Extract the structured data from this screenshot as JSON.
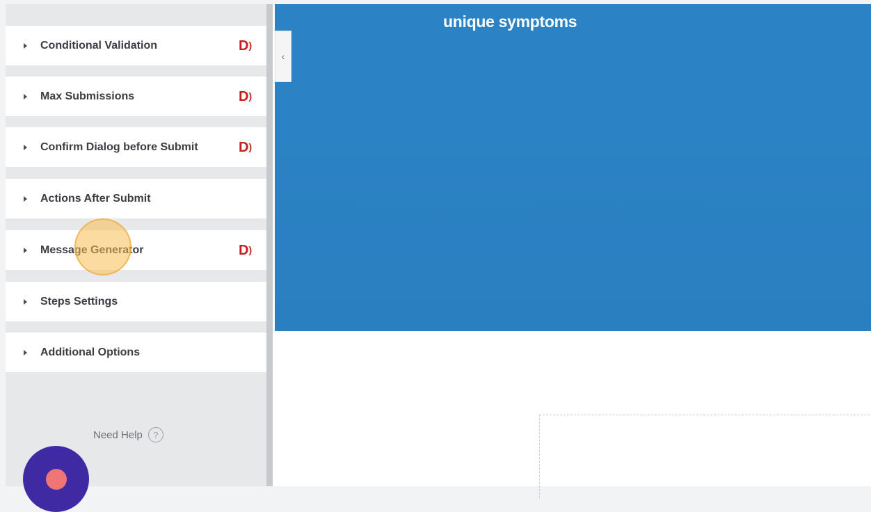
{
  "sidebar": {
    "sections": [
      {
        "label": "Conditional Validation",
        "pro": true
      },
      {
        "label": "Max Submissions",
        "pro": true
      },
      {
        "label": "Confirm Dialog before Submit",
        "pro": true
      },
      {
        "label": "Actions After Submit",
        "pro": false
      },
      {
        "label": "Message Generator",
        "pro": true
      },
      {
        "label": "Steps Settings",
        "pro": false
      },
      {
        "label": "Additional Options",
        "pro": false
      }
    ],
    "pro_badge_text": "D",
    "pro_badge_color": "#c2201d",
    "help_text": "Need Help",
    "help_icon": "question-circle-icon"
  },
  "preview": {
    "hero_title": "unique symptoms",
    "hero_color": "#2b82c4",
    "collapse_icon": "chevron-left-icon",
    "collapse_glyph": "‹"
  },
  "chat": {
    "launcher_color": "#3f2aa3",
    "dot_color": "#f07577"
  }
}
